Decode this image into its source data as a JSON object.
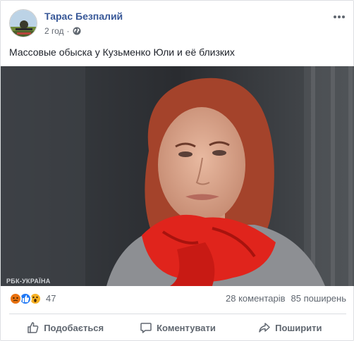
{
  "post": {
    "author": "Тарас Безпалий",
    "time": "2 год",
    "privacy_icon": "globe-icon",
    "text": "Массовые обыска у Кузьменко Юли и её близких",
    "photo_watermark": "РБК-УКРАЇНА"
  },
  "stats": {
    "reactions": [
      "angry",
      "like",
      "wow"
    ],
    "reaction_count": "47",
    "comments": "28 коментарів",
    "shares": "85 поширень"
  },
  "actions": {
    "like": "Подобається",
    "comment": "Коментувати",
    "share": "Поширити"
  },
  "colors": {
    "link": "#385898",
    "muted": "#606770",
    "like": "#2078f4",
    "angry": "#e9710f",
    "wow": "#f7b125"
  }
}
